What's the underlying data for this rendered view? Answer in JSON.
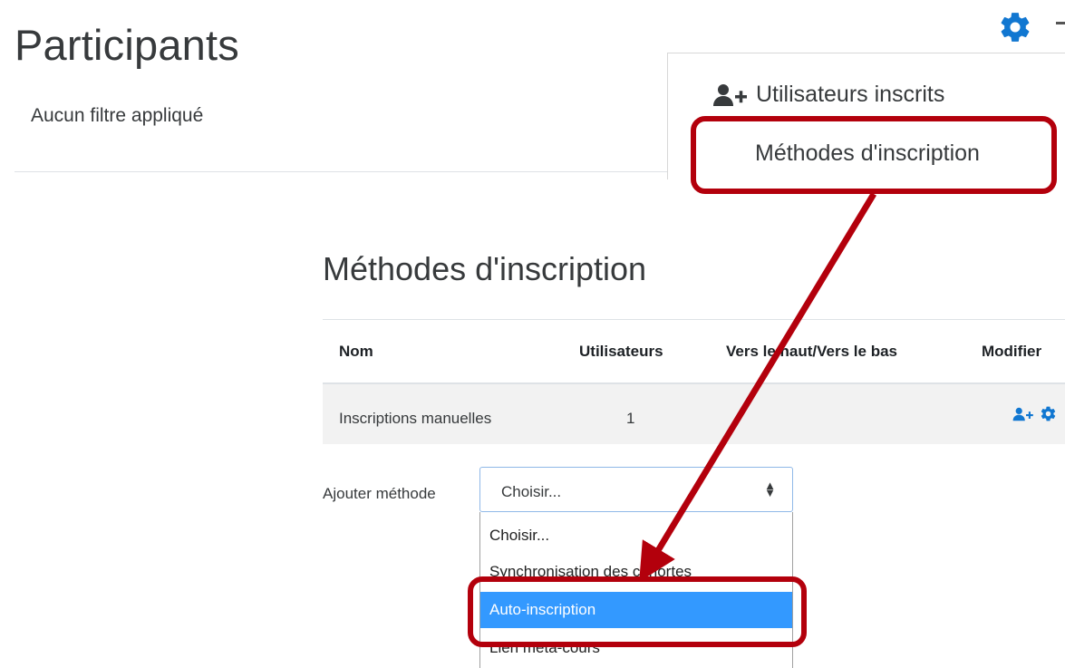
{
  "page": {
    "title": "Participants",
    "filter_status": "Aucun filtre appliqué"
  },
  "settings_menu": {
    "items": [
      {
        "label": "Utilisateurs inscrits",
        "icon": "user-plus-icon"
      },
      {
        "label": "Méthodes d'inscription"
      }
    ]
  },
  "enrolment": {
    "title": "Méthodes d'inscription",
    "columns": [
      "Nom",
      "Utilisateurs",
      "Vers le haut/Vers le bas",
      "Modifier"
    ],
    "rows": [
      {
        "name": "Inscriptions manuelles",
        "users": "1"
      }
    ],
    "add_method": {
      "label": "Ajouter méthode",
      "selected": "Choisir...",
      "options": [
        "Choisir...",
        "Synchronisation des cohortes",
        "Auto-inscription",
        "Lien méta-cours"
      ],
      "highlighted_option": "Auto-inscription"
    }
  },
  "colors": {
    "annotation_red": "#b3000c",
    "link_blue": "#1177d1",
    "selected_blue": "#3399ff"
  }
}
